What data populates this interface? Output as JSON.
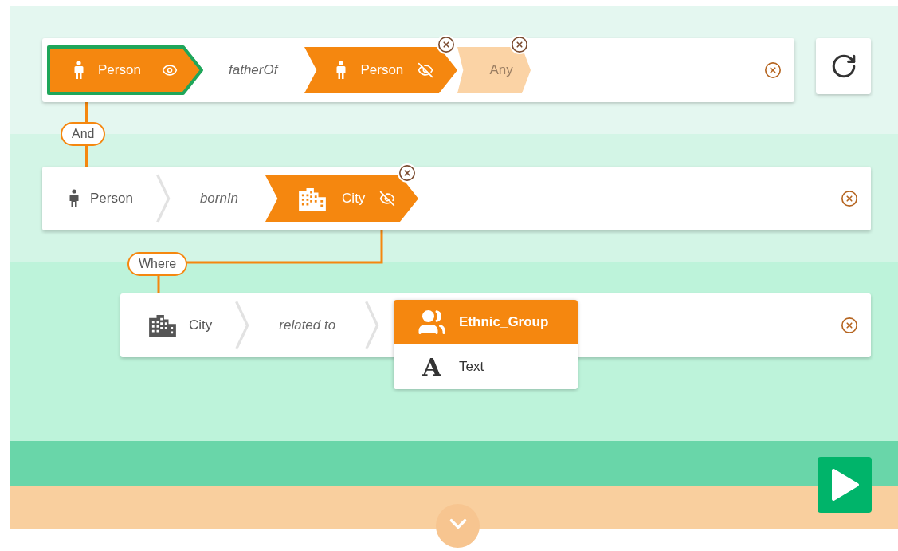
{
  "rows": [
    {
      "items": [
        {
          "kind": "personchip",
          "label": "Person",
          "selected": true,
          "visible": true,
          "removable": false
        },
        {
          "kind": "relation",
          "label": "fatherOf"
        },
        {
          "kind": "personchip",
          "label": "Person",
          "selected": false,
          "visible": false,
          "removable": true
        },
        {
          "kind": "anychip",
          "label": "Any",
          "removable": true
        }
      ]
    },
    {
      "connector": "And",
      "items": [
        {
          "kind": "person",
          "label": "Person"
        },
        {
          "kind": "separator"
        },
        {
          "kind": "relation",
          "label": "bornIn"
        },
        {
          "kind": "citychip",
          "label": "City",
          "selected": false,
          "visible": false,
          "removable": true
        }
      ]
    },
    {
      "connector": "Where",
      "items": [
        {
          "kind": "city",
          "label": "City"
        },
        {
          "kind": "separator"
        },
        {
          "kind": "relation",
          "label": "related to"
        },
        {
          "kind": "separator"
        }
      ],
      "dropdown": [
        {
          "kind": "group",
          "label": "Ethnic_Group",
          "selected": true
        },
        {
          "kind": "letter",
          "glyph": "A",
          "label": "Text",
          "selected": false
        }
      ]
    }
  ]
}
